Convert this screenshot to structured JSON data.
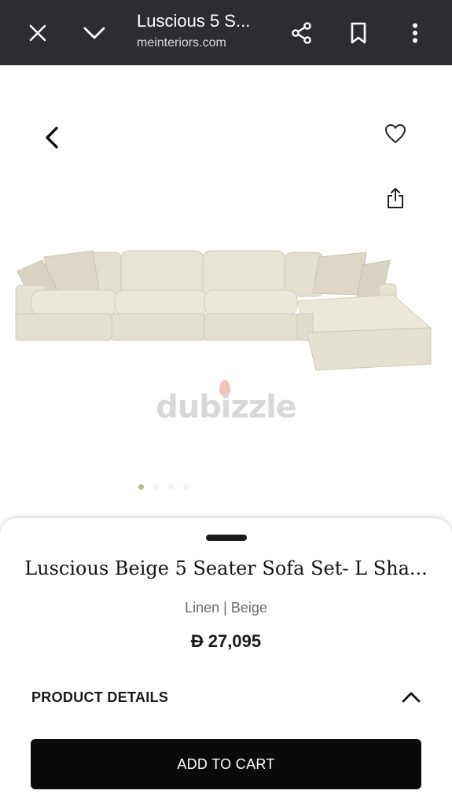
{
  "browser": {
    "title": "Luscious 5 S...",
    "url": "meinteriors.com"
  },
  "gallery": {
    "watermark": "dubizzle",
    "slide_count": 4,
    "active_slide": 1
  },
  "product": {
    "title": "Luscious Beige 5 Seater Sofa Set- L Sha...",
    "variant": "Linen | Beige",
    "currency": "Đ",
    "price": "27,095"
  },
  "details": {
    "label": "PRODUCT DETAILS"
  },
  "cart": {
    "label": "ADD TO CART"
  },
  "icons": {
    "close": "close-icon",
    "collapse": "chevron-down-icon",
    "share": "share-icon",
    "bookmark": "bookmark-icon",
    "menu": "more-vertical-icon",
    "back": "chevron-left-icon",
    "wishlist": "heart-icon",
    "share_product": "share-upload-icon",
    "details_toggle": "chevron-up-icon"
  },
  "colors": {
    "topbar": "#2b2d30",
    "button": "#0a0a0a",
    "active_dot": "#b4bb86",
    "sofa": "#e7e3d6"
  }
}
